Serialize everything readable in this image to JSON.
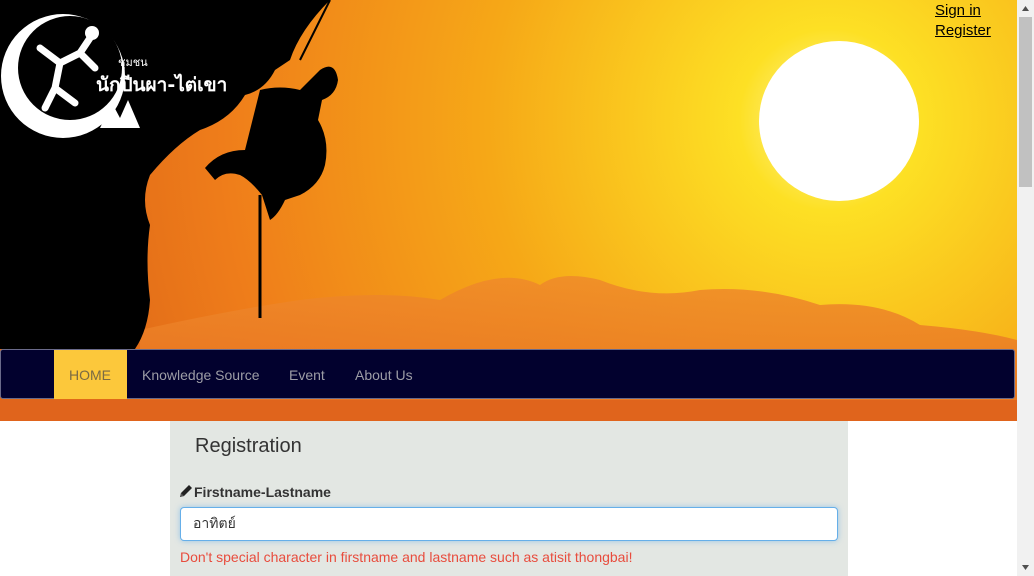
{
  "header": {
    "logo_subtitle": "ชุมชน",
    "logo_title": "นักปีนผา-ไต่เขา",
    "sign_in": "Sign in",
    "register": "Register"
  },
  "nav": {
    "items": [
      {
        "label": "HOME",
        "active": true
      },
      {
        "label": "Knowledge Source"
      },
      {
        "label": "Event"
      },
      {
        "label": "About Us"
      }
    ]
  },
  "form": {
    "title": "Registration",
    "firstname_label": "Firstname-Lastname",
    "firstname_value": "อาทิตย์",
    "firstname_error": "Don't special character in firstname and lastname such as atisit thongbai!"
  },
  "colors": {
    "navbar_bg": "#02012e",
    "active_tab": "#fcc83b",
    "panel_bg": "#e3e7e3",
    "error_text": "#e84c3d"
  },
  "icons": [
    "logo-climber-icon",
    "pencil-icon",
    "scroll-up-arrow-icon",
    "scroll-down-arrow-icon"
  ]
}
